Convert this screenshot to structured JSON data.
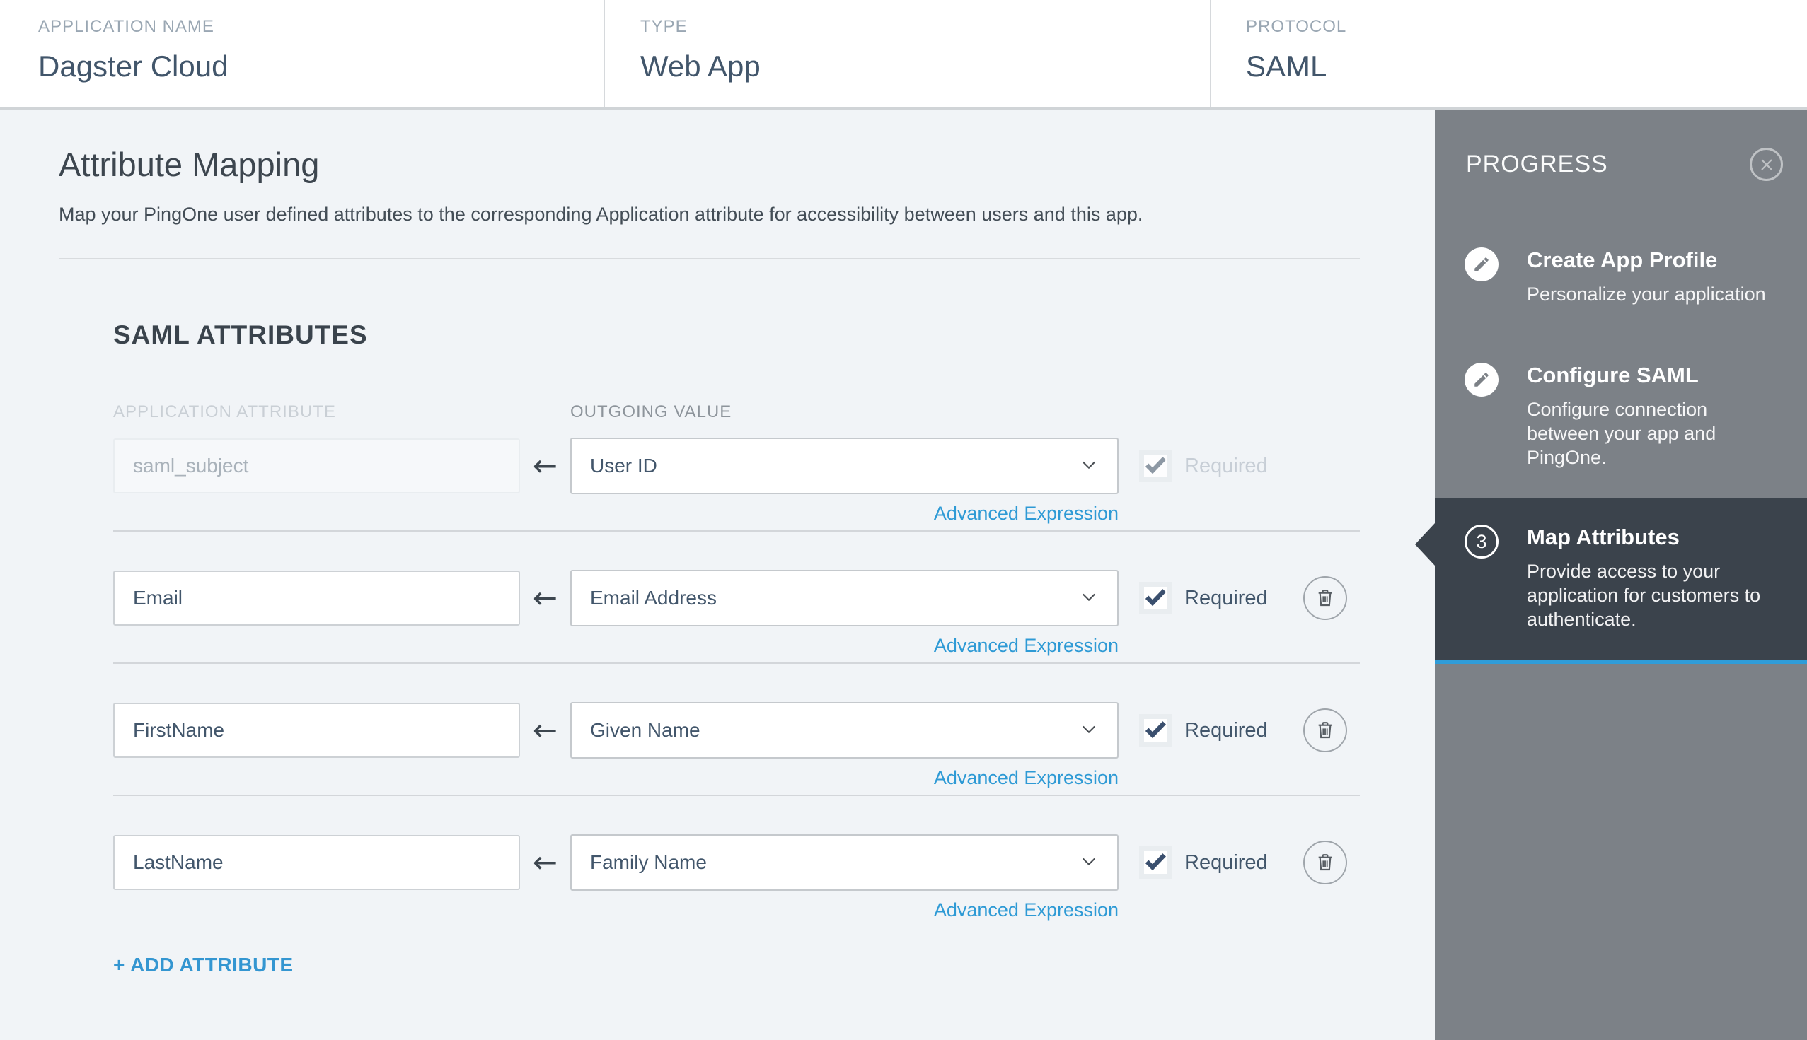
{
  "header": {
    "fields": [
      {
        "label": "APPLICATION NAME",
        "value": "Dagster Cloud"
      },
      {
        "label": "TYPE",
        "value": "Web App"
      },
      {
        "label": "PROTOCOL",
        "value": "SAML"
      }
    ]
  },
  "main": {
    "title": "Attribute Mapping",
    "description": "Map your PingOne user defined attributes to the corresponding Application attribute for accessibility between users and this app.",
    "section_title": "SAML ATTRIBUTES",
    "columns": {
      "application_attribute": "APPLICATION ATTRIBUTE",
      "outgoing_value": "OUTGOING VALUE"
    },
    "advanced_expression_label": "Advanced Expression",
    "required_label": "Required",
    "add_attribute_label": "+ ADD ATTRIBUTE",
    "rows": [
      {
        "application_attribute": "saml_subject",
        "outgoing_value": "User ID",
        "required": true,
        "disabled": true,
        "deletable": false
      },
      {
        "application_attribute": "Email",
        "outgoing_value": "Email Address",
        "required": true,
        "disabled": false,
        "deletable": true
      },
      {
        "application_attribute": "FirstName",
        "outgoing_value": "Given Name",
        "required": true,
        "disabled": false,
        "deletable": true
      },
      {
        "application_attribute": "LastName",
        "outgoing_value": "Family Name",
        "required": true,
        "disabled": false,
        "deletable": true
      }
    ]
  },
  "progress": {
    "title": "PROGRESS",
    "steps": [
      {
        "title": "Create App Profile",
        "description": "Personalize your application",
        "state": "complete"
      },
      {
        "title": "Configure SAML",
        "description": "Configure connection between your app and PingOne.",
        "state": "complete"
      },
      {
        "number": "3",
        "title": "Map Attributes",
        "description": "Provide access to your application for customers to authenticate.",
        "state": "active"
      }
    ]
  },
  "icons": {
    "arrow_left": "←",
    "pencil": "pencil-icon",
    "trash": "trash-icon",
    "close": "close-icon",
    "chevron_down": "chevron-down-icon",
    "check": "check-icon"
  },
  "colors": {
    "accent_blue": "#2e9ad5",
    "active_step_underline": "#2f9cd8",
    "sidebar_gray": "#7c8187",
    "active_step_bg": "#3b434c",
    "content_bg": "#f1f4f7",
    "text_dark": "#42566b"
  }
}
